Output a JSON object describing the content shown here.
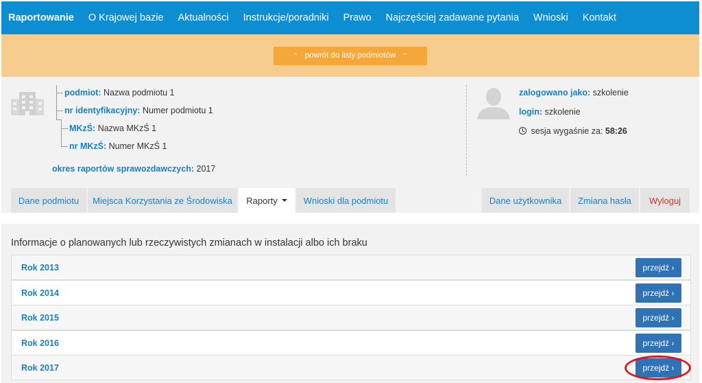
{
  "nav": {
    "items": [
      "Raportowanie",
      "O Krajowej bazie",
      "Aktualności",
      "Instrukcje/poradniki",
      "Prawo",
      "Najczęściej zadawane pytania",
      "Wnioski",
      "Kontakt"
    ]
  },
  "banner": {
    "back_label": "powrót do listy podmiotów"
  },
  "entity": {
    "podmiot_key": "podmiot:",
    "podmiot_val": "Nazwa podmiotu 1",
    "nr_key": "nr identyfikacyjny:",
    "nr_val": "Numer podmiotu 1",
    "mkzs_key": "MKzŚ:",
    "mkzs_val": "Nazwa MKzŚ 1",
    "nr_mkzs_key": "nr MKzŚ:",
    "nr_mkzs_val": "Numer MKzŚ 1",
    "okres_key": "okres raportów sprawozdawczych:",
    "okres_val": "2017"
  },
  "user": {
    "logged_key": "zalogowano jako:",
    "logged_val": "szkolenie",
    "login_key": "login:",
    "login_val": "szkolenie",
    "session_label": "sesja wygaśnie za:",
    "session_time": "58:26"
  },
  "tabs": {
    "dane_podmiotu": "Dane podmiotu",
    "miejsca": "Miejsca Korzystania ze Środowiska",
    "raporty": "Raporty",
    "wnioski": "Wnioski dla podmiotu",
    "dane_uzytkownika": "Dane użytkownika",
    "zmiana_hasla": "Zmiana hasła",
    "wyloguj": "Wyloguj"
  },
  "content": {
    "title": "Informacje o planowanych lub rzeczywistych zmianach w instalacji albo ich braku",
    "rows": [
      {
        "label": "Rok 2013",
        "button": "przejdź ›"
      },
      {
        "label": "Rok 2014",
        "button": "przejdź ›"
      },
      {
        "label": "Rok 2015",
        "button": "przejdź ›"
      },
      {
        "label": "Rok 2016",
        "button": "przejdź ›"
      },
      {
        "label": "Rok 2017",
        "button": "przejdź ›"
      }
    ]
  },
  "colors": {
    "navbar": "#0d8ed3",
    "banner": "#f7cd8f",
    "back_button": "#f6a73a",
    "link": "#1a7fc0",
    "primary_button": "#2f73b6",
    "highlight": "#e0151b"
  }
}
